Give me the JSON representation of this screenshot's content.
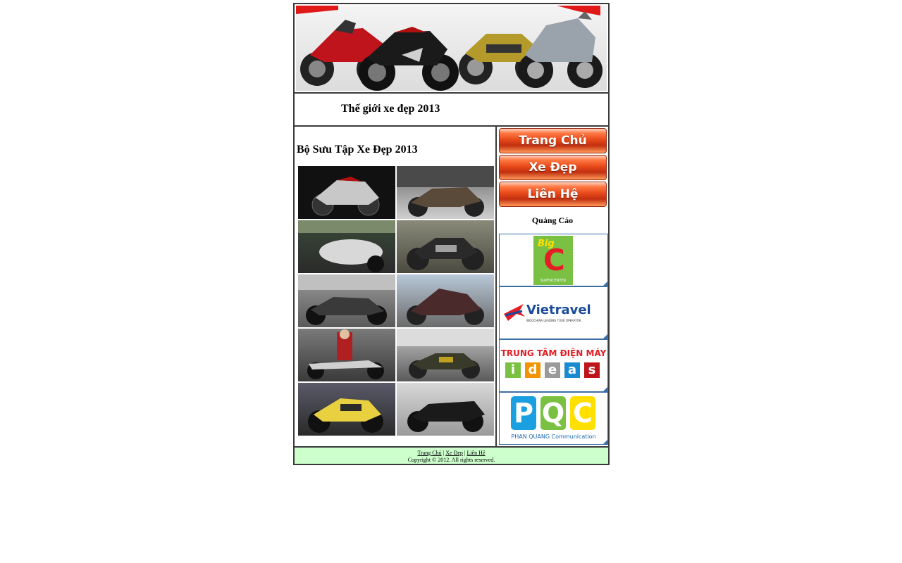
{
  "site": {
    "title": "Thế giới xe đẹp 2013"
  },
  "gallery": {
    "title": "Bộ Sưu Tập Xe Đẹp 2013",
    "count": 10
  },
  "nav": {
    "items": [
      {
        "label": "Trang Chủ"
      },
      {
        "label": "Xe Đẹp"
      },
      {
        "label": "Liên Hệ"
      }
    ]
  },
  "ads": {
    "title": "Quảng Cáo",
    "items": [
      {
        "brand": "Big C",
        "big": "Big",
        "c": "C",
        "sub": "SUPERCENTER"
      },
      {
        "brand": "Vietravel",
        "name": "Vietravel",
        "tag": "INDOCHINA LEADING TOUR OPERATOR"
      },
      {
        "brand": "Ideas",
        "line1": "TRUNG TÂM ĐIỆN MÁY",
        "letters": [
          "i",
          "d",
          "e",
          "a",
          "s"
        ]
      },
      {
        "brand": "PQC",
        "letters": [
          "P",
          "Q",
          "C"
        ],
        "sub": "PHAN QUANG Communication"
      }
    ]
  },
  "footer": {
    "links": [
      "Trang Chủ",
      "Xe Đẹp",
      "Liên Hệ"
    ],
    "separator": "|",
    "copyright": "Copyright © 2012. All rights reserved."
  },
  "colors": {
    "footer_bg": "#ccffcc",
    "nav_red": "#e84a1a",
    "border": "#3b3b3b"
  }
}
